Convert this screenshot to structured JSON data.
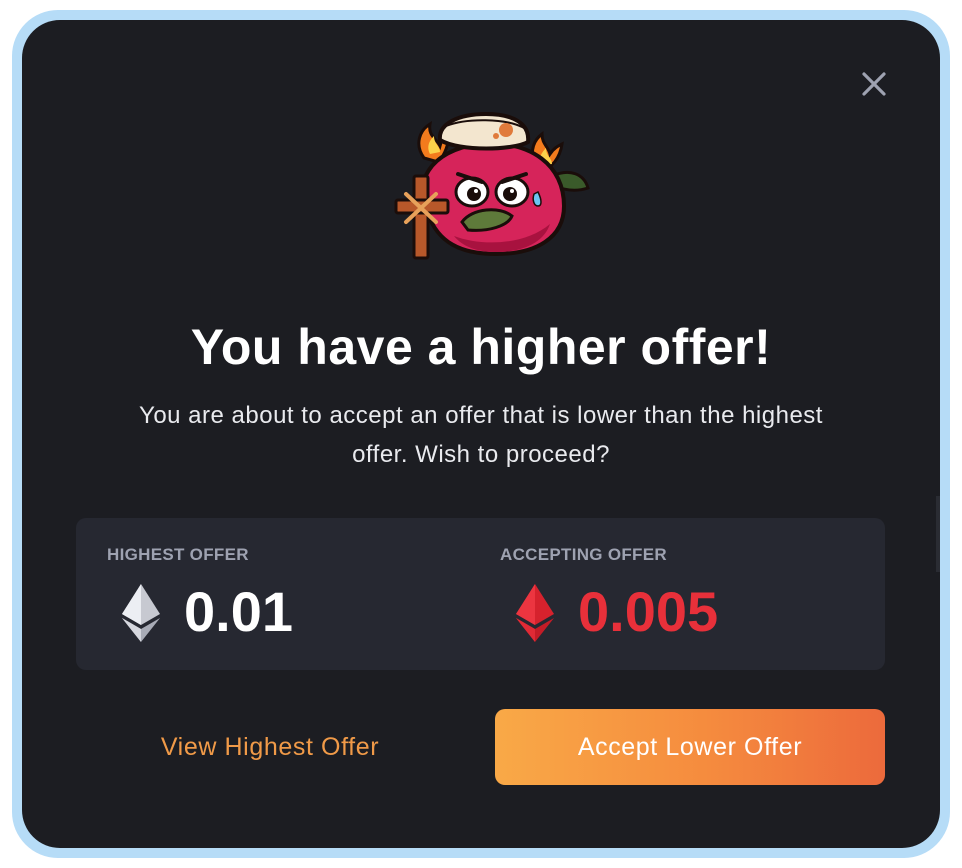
{
  "modal": {
    "title": "You have a higher offer!",
    "subtitle": "You are about to accept an offer that is lower than the highest offer. Wish to proceed?",
    "close_icon": "close-x-icon",
    "avatar_icon": "axie-creature-avatar-icon"
  },
  "offers": {
    "highest": {
      "label": "HIGHEST OFFER",
      "value": "0.01",
      "currency_icon": "eth-diamond-icon",
      "color": "#ffffff",
      "icon_color": "#b9bcc6"
    },
    "accepting": {
      "label": "ACCEPTING OFFER",
      "value": "0.005",
      "currency_icon": "eth-diamond-icon",
      "color": "#e8303a",
      "icon_color": "#e02a35"
    }
  },
  "actions": {
    "view_highest_label": "View Highest Offer",
    "accept_lower_label": "Accept Lower Offer"
  },
  "colors": {
    "background": "#1c1d22",
    "panel": "#262831",
    "frame_border": "#b6dcf7",
    "accent_orange": "#f09a48",
    "danger_red": "#e8303a"
  }
}
